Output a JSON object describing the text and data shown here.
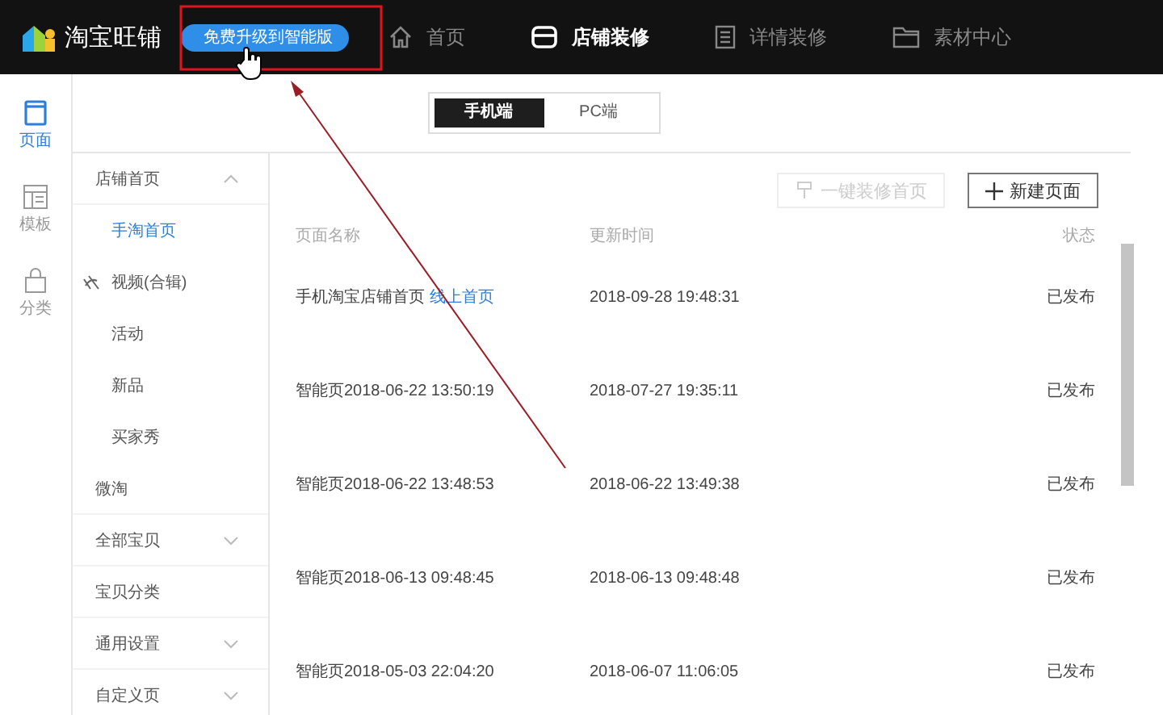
{
  "topbar": {
    "logo": "淘宝旺铺",
    "upgrade_button": "免费升级到智能版",
    "nav": [
      {
        "label": "首页",
        "selected": false
      },
      {
        "label": "店铺装修",
        "selected": true
      },
      {
        "label": "详情装修",
        "selected": false
      },
      {
        "label": "素材中心",
        "selected": false
      }
    ]
  },
  "rail": [
    {
      "label": "页面",
      "selected": true
    },
    {
      "label": "模板",
      "selected": false
    },
    {
      "label": "分类",
      "selected": false
    }
  ],
  "device_tabs": [
    {
      "label": "手机端",
      "selected": true
    },
    {
      "label": "PC端",
      "selected": false
    }
  ],
  "sidebar": {
    "items": [
      {
        "label": "店铺首页",
        "expanded": true,
        "children": [
          {
            "label": "手淘首页",
            "kind": "page",
            "selected": true
          },
          {
            "label": "视频(合辑)",
            "kind": "video",
            "selected": false
          },
          {
            "label": "活动",
            "kind": "page",
            "selected": false
          },
          {
            "label": "新品",
            "kind": "page",
            "selected": false
          },
          {
            "label": "买家秀",
            "kind": "page",
            "selected": false
          }
        ]
      },
      {
        "label": "微淘"
      },
      {
        "label": "全部宝贝",
        "expanded": false
      },
      {
        "label": "宝贝分类"
      },
      {
        "label": "通用设置",
        "expanded": false
      },
      {
        "label": "自定义页",
        "expanded": false
      }
    ]
  },
  "actions": [
    {
      "label": "一键装修首页",
      "disabled": true
    },
    {
      "label": "新建页面",
      "disabled": false
    }
  ],
  "table": {
    "columns": [
      "页面名称",
      "更新时间",
      "状态"
    ],
    "rows": [
      {
        "name": "手机淘宝店铺首页",
        "link": "线上首页",
        "updated": "2018-09-28 19:48:31",
        "status": "已发布"
      },
      {
        "name": "智能页2018-06-22 13:50:19",
        "updated": "2018-07-27 19:35:11",
        "status": "已发布"
      },
      {
        "name": "智能页2018-06-22 13:48:53",
        "updated": "2018-06-22 13:49:38",
        "status": "已发布"
      },
      {
        "name": "智能页2018-06-13 09:48:45",
        "updated": "2018-06-13 09:48:48",
        "status": "已发布"
      },
      {
        "name": "智能页2018-05-03 22:04:20",
        "updated": "2018-06-07 11:06:05",
        "status": "已发布"
      }
    ]
  }
}
